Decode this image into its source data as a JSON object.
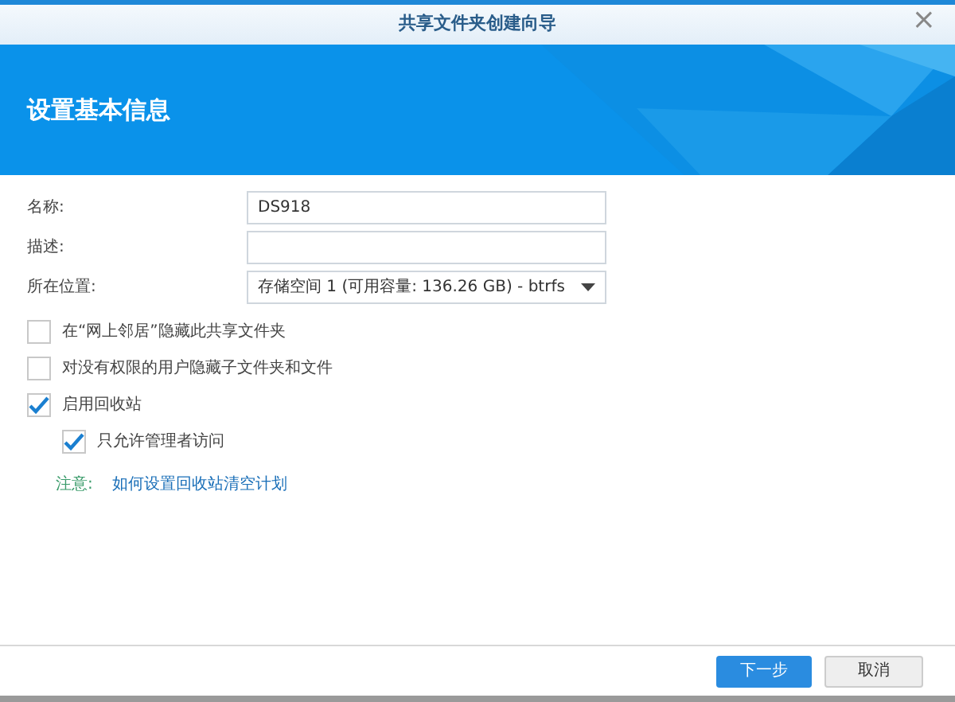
{
  "window": {
    "title": "共享文件夹创建向导",
    "close": "×"
  },
  "header": {
    "title": "设置基本信息"
  },
  "fields": [
    {
      "label": "名称:",
      "value": "DS918",
      "kind": "text"
    },
    {
      "label": "描述:",
      "kind": "text"
    },
    {
      "label": "所在位置:",
      "value": "存储空间 1 (可用容量:  136.26 GB) - btrfs",
      "kind": "select"
    }
  ],
  "options": [
    {
      "label": "在“网上邻居”隐藏此共享文件夹",
      "checked": false
    },
    {
      "label": "对没有权限的用户隐藏子文件夹和文件",
      "checked": false
    },
    {
      "label": "启用回收站",
      "checked": true,
      "children": [
        {
          "label": "只允许管理者访问",
          "checked": true
        }
      ]
    }
  ],
  "note": {
    "label": "注意:",
    "link": "如何设置回收站清空计划"
  },
  "buttons": [
    {
      "label": "下一步",
      "kind": "primary"
    },
    {
      "label": "取消",
      "kind": "secondary"
    }
  ]
}
